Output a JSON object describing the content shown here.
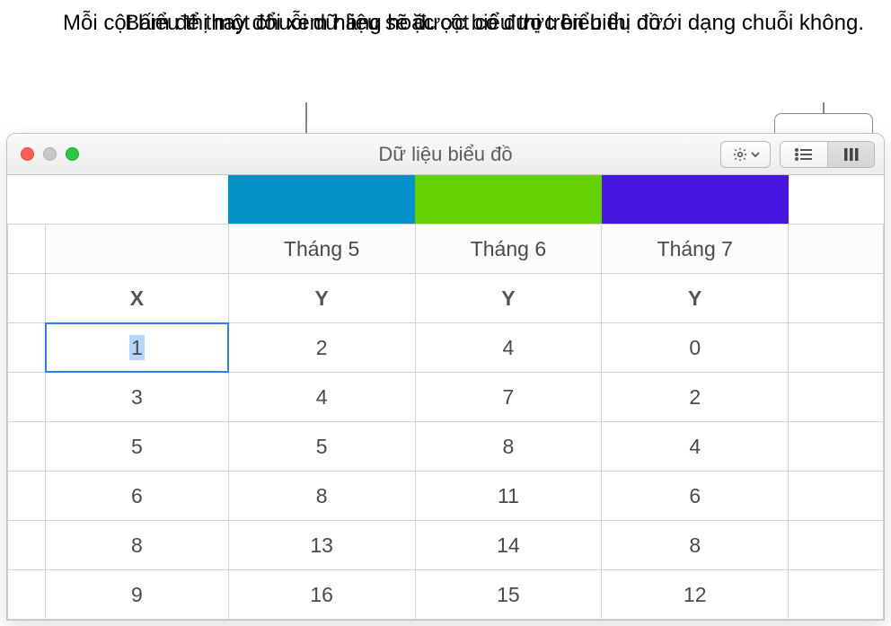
{
  "callouts": {
    "left": "Mỗi cột biểu thị một chuỗi dữ liệu sẽ được biểu thị trên biểu đồ.",
    "right": "Bấm để thay đổi xem hàng hoặc cột có được biểu thị dưới dạng chuỗi không."
  },
  "window": {
    "title": "Dữ liệu biểu đồ"
  },
  "columns": {
    "series": [
      "Tháng 5",
      "Tháng 6",
      "Tháng 7"
    ],
    "axis_labels": [
      "X",
      "Y",
      "Y",
      "Y"
    ],
    "colors": [
      "#0591c7",
      "#64d200",
      "#4617e0"
    ]
  },
  "chart_data": {
    "type": "table",
    "rows": [
      {
        "x": "1",
        "y": [
          "2",
          "4",
          "0"
        ]
      },
      {
        "x": "3",
        "y": [
          "4",
          "7",
          "2"
        ]
      },
      {
        "x": "5",
        "y": [
          "5",
          "8",
          "4"
        ]
      },
      {
        "x": "6",
        "y": [
          "8",
          "11",
          "6"
        ]
      },
      {
        "x": "8",
        "y": [
          "13",
          "14",
          "8"
        ]
      },
      {
        "x": "9",
        "y": [
          "16",
          "15",
          "12"
        ]
      }
    ]
  }
}
